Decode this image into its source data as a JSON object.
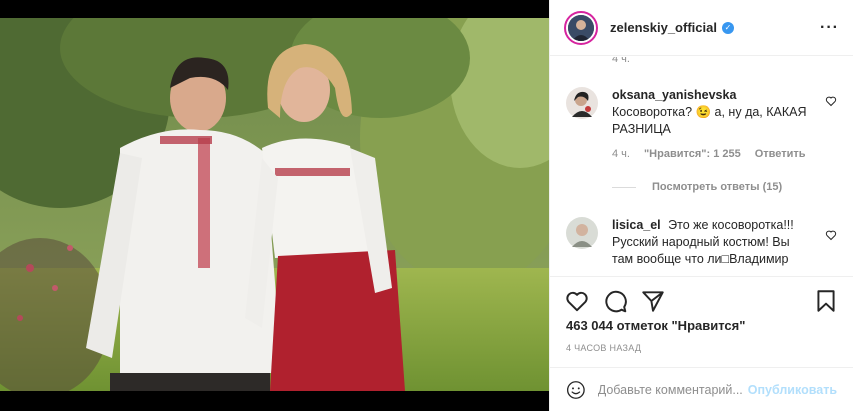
{
  "post": {
    "username": "zelenskiy_official",
    "verified_mark": "✓",
    "more_label": "···",
    "photo_alt": "Couple in embroidered shirts in garden"
  },
  "comments": {
    "clipped_time": "4 ч.",
    "items": [
      {
        "user": "oksana_yanishevska",
        "text": "Косоворотка? 😉 а, ну да, КАКАЯ РАЗНИЦА",
        "time": "4 ч.",
        "likes": "\"Нравится\": 1 255",
        "reply": "Ответить",
        "view_replies": "Посмотреть ответы (15)"
      },
      {
        "user": "lisica_el",
        "text": "Это же косоворотка!!! Русский народный костюм! Вы там вообще что ли□Владимир"
      }
    ]
  },
  "actions": {
    "like_icon": "heart-icon",
    "comment_icon": "comment-icon",
    "share_icon": "share-icon",
    "save_icon": "bookmark-icon"
  },
  "likes_text": "463 044 отметок \"Нравится\"",
  "posted_time": "4 ЧАСОВ НАЗАД",
  "add_comment": {
    "placeholder": "Добавьте комментарий...",
    "publish_label": "Опубликовать"
  },
  "colors": {
    "accent": "#3897f0",
    "publish_disabled": "#b2dffc",
    "muted": "#8e8e8e"
  }
}
